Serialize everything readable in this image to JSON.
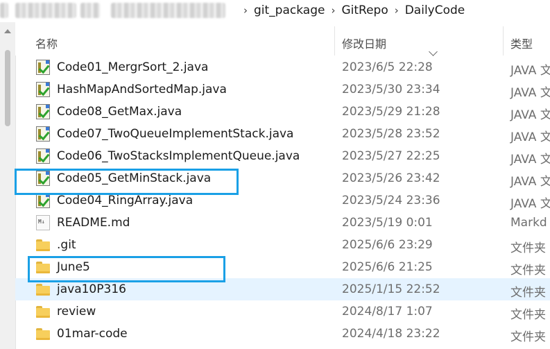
{
  "breadcrumb": {
    "path": [
      "git_package",
      "GitRepo",
      "DailyCode"
    ],
    "separator": "›"
  },
  "columns": {
    "name": "名称",
    "date": "修改日期",
    "type": "类型"
  },
  "files": [
    {
      "name": "Code01_MergrSort_2.java",
      "date": "2023/6/5 22:28",
      "type": "JAVA 文",
      "icon": "java-file-icon"
    },
    {
      "name": "HashMapAndSortedMap.java",
      "date": "2023/5/30 23:34",
      "type": "JAVA 文",
      "icon": "java-file-icon"
    },
    {
      "name": "Code08_GetMax.java",
      "date": "2023/5/29 21:28",
      "type": "JAVA 文",
      "icon": "java-file-icon"
    },
    {
      "name": "Code07_TwoQueueImplementStack.java",
      "date": "2023/5/28 23:52",
      "type": "JAVA 文",
      "icon": "java-file-icon"
    },
    {
      "name": "Code06_TwoStacksImplementQueue.java",
      "date": "2023/5/27 22:25",
      "type": "JAVA 文",
      "icon": "java-file-icon"
    },
    {
      "name": "Code05_GetMinStack.java",
      "date": "2023/5/26 23:42",
      "type": "JAVA 文",
      "icon": "java-file-icon"
    },
    {
      "name": "Code04_RingArray.java",
      "date": "2023/5/24 23:36",
      "type": "JAVA 文",
      "icon": "java-file-icon"
    },
    {
      "name": "README.md",
      "date": "2023/5/19 0:01",
      "type": "Markd",
      "icon": "markdown-file-icon"
    },
    {
      "name": ".git",
      "date": "2025/6/6 23:29",
      "type": "文件夹",
      "icon": "folder-icon"
    },
    {
      "name": "June5",
      "date": "2025/6/6 21:25",
      "type": "文件夹",
      "icon": "folder-icon"
    },
    {
      "name": "java10P316",
      "date": "2025/1/15 22:52",
      "type": "文件夹",
      "icon": "folder-icon"
    },
    {
      "name": "review",
      "date": "2024/8/17 1:07",
      "type": "文件夹",
      "icon": "folder-icon"
    },
    {
      "name": "01mar-code",
      "date": "2024/4/18 23:22",
      "type": "文件夹",
      "icon": "folder-icon"
    }
  ],
  "md_icon_glyph": "M↓",
  "colors": {
    "highlight_box": "#1aa0e6",
    "hover_row": "#e5f3ff"
  }
}
